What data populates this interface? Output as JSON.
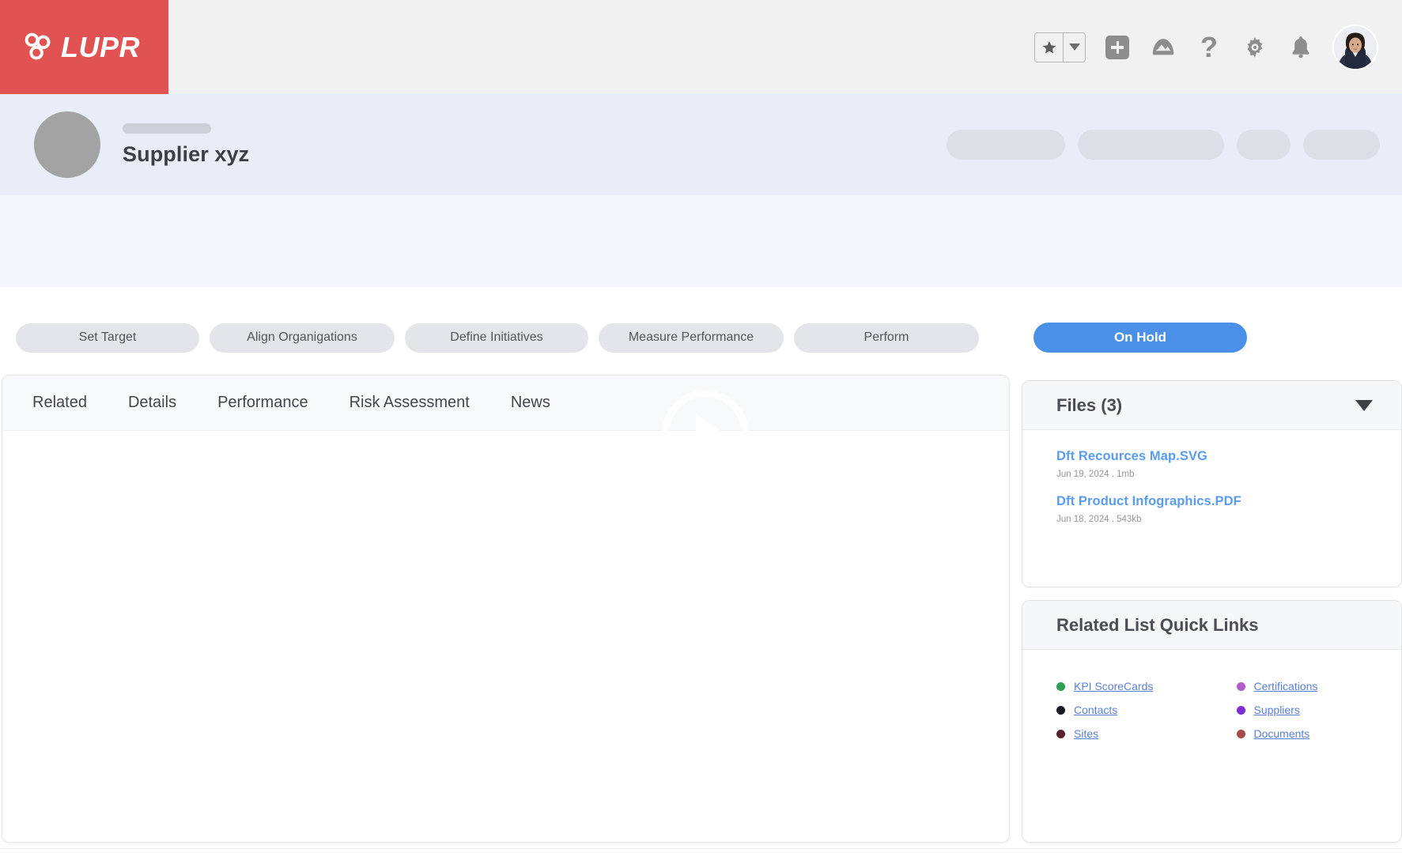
{
  "global_nav": {
    "brand": {
      "word": "LUPR",
      "logo_icon": "lupr-trefoil-logo-icon",
      "bg_color": "#e15252"
    },
    "actions": [
      {
        "name": "favorites-star",
        "icon": "star-icon"
      },
      {
        "name": "favorites-dropdown",
        "icon": "chevron-down-icon"
      },
      {
        "name": "new-record",
        "icon": "plus-icon"
      },
      {
        "name": "cloud-upload",
        "icon": "cloud-icon"
      },
      {
        "name": "help",
        "icon": "question-mark-icon",
        "glyph": "?"
      },
      {
        "name": "settings",
        "icon": "gear-icon"
      },
      {
        "name": "notifications",
        "icon": "bell-icon"
      },
      {
        "name": "user-profile",
        "icon": "avatar-photo"
      }
    ]
  },
  "record_header": {
    "title": "Supplier xyz",
    "subtitle_placeholder": "",
    "avatar_icon": "record-avatar-placeholder",
    "action_placeholders": [
      "",
      "",
      "",
      ""
    ]
  },
  "stage_path": {
    "stages": [
      {
        "label": "Set Target"
      },
      {
        "label": "Align Organigations"
      },
      {
        "label": "Define Initiatives"
      },
      {
        "label": "Measure Performance"
      },
      {
        "label": "Perform"
      }
    ],
    "status_button": {
      "label": "On Hold",
      "color": "#4a90e8"
    }
  },
  "main": {
    "tabs": [
      {
        "label": "Related"
      },
      {
        "label": "Details"
      },
      {
        "label": "Performance"
      },
      {
        "label": "Risk Assessment"
      },
      {
        "label": "News"
      }
    ],
    "active_tab": "Related",
    "body_text": ""
  },
  "overlay": {
    "icon": "play-button-icon"
  },
  "files_card": {
    "title": "Files (3)",
    "collapse_icon": "caret-down-icon",
    "count": 3,
    "items": [
      {
        "name": "Dft Recources Map.SVG",
        "meta": "Jun 19, 2024 . 1mb",
        "date": "Jun 19, 2024",
        "size": "1mb"
      },
      {
        "name": "Dft Product Infographics.PDF",
        "meta": "Jun 18, 2024 . 543kb",
        "date": "Jun 18, 2024",
        "size": "543kb"
      }
    ],
    "link_color": "#5a9cf0"
  },
  "quick_links_card": {
    "title": "Related List Quick Links",
    "left_column": [
      {
        "label": "KPI ScoreCards",
        "dot_color": "#2e9e4f"
      },
      {
        "label": "Contacts",
        "dot_color": "#1a1a22"
      },
      {
        "label": "Sites",
        "dot_color": "#5c1f2e"
      }
    ],
    "right_column": [
      {
        "label": "Certifications",
        "dot_color": "#b35cc9"
      },
      {
        "label": "Suppliers",
        "dot_color": "#7b2fd4"
      },
      {
        "label": "Documents",
        "dot_color": "#a64a4a"
      }
    ],
    "link_color": "#5a7fd6"
  },
  "theme": {
    "brand_red": "#e15252",
    "nav_bg": "#f1f1f1",
    "record_header_bg": "#e9edf7",
    "band_bg": "#f4f6fb",
    "accent_blue": "#4a90e8",
    "stage_pill_bg": "#e3e5e9"
  }
}
